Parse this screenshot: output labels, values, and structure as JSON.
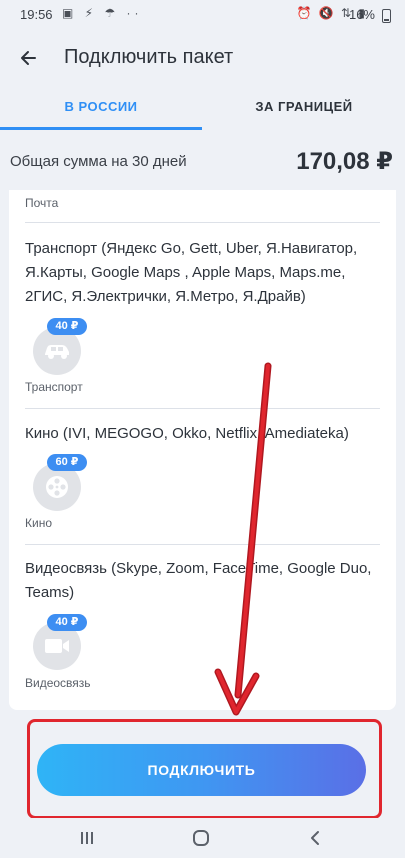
{
  "status_bar": {
    "time": "19:56",
    "left_icons": "▣ ⚡ ☂ ··",
    "right_icons": "⏰ 🔇 ⇅ ▮",
    "battery": "16%"
  },
  "header": {
    "title": "Подключить пакет"
  },
  "tabs": [
    {
      "label": "В РОССИИ",
      "active": true
    },
    {
      "label": "ЗА ГРАНИЦЕЙ",
      "active": false
    }
  ],
  "summary": {
    "label": "Общая сумма на 30 дней",
    "amount": "170,08 ₽"
  },
  "services": [
    {
      "label": "Почта"
    },
    {
      "description": "Транспорт (Яндекс Go, Gett, Uber, Я.Навигатор, Я.Карты, Google Maps , Apple Maps, Maps.me, 2ГИС, Я.Электрички, Я.Метро, Я.Драйв)",
      "price": "40 ₽",
      "icon": "car-icon",
      "label": "Транспорт"
    },
    {
      "description": "Кино (IVI, MEGOGO, Okko, Netflix, Amediateka)",
      "price": "60 ₽",
      "icon": "film-reel-icon",
      "label": "Кино"
    },
    {
      "description": "Видеосвязь (Skype, Zoom, FaceTime, Google Duo, Teams)",
      "price": "40 ₽",
      "icon": "video-camera-icon",
      "label": "Видеосвязь"
    }
  ],
  "connect_button": {
    "label": "ПОДКЛЮЧИТЬ"
  },
  "colors": {
    "accent": "#2f8ff5",
    "badge": "#3d8ef2",
    "highlight": "#e0262e",
    "background": "#eef1f6"
  }
}
